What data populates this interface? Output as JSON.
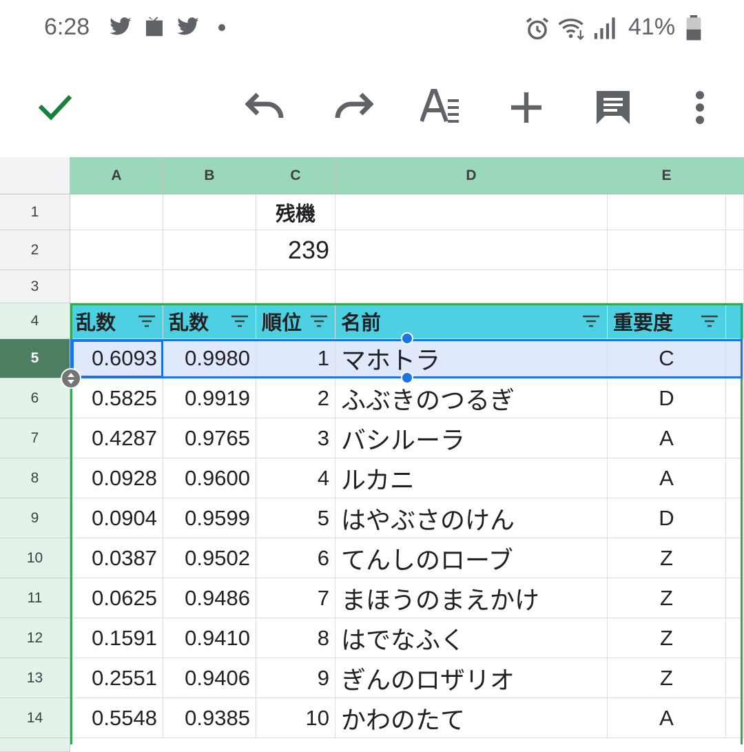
{
  "status_bar": {
    "time": "6:28",
    "battery": "41%",
    "icons": [
      "twitter-icon",
      "tv-icon",
      "twitter-icon",
      "dot-icon",
      "alarm-icon",
      "wifi-icon",
      "signal-icon",
      "battery-icon"
    ]
  },
  "toolbar": {
    "icons": [
      "check-icon",
      "undo-icon",
      "redo-icon",
      "text-format-icon",
      "add-icon",
      "comment-icon",
      "more-vert-icon"
    ],
    "accent": "#188038"
  },
  "sheet": {
    "columns": [
      "A",
      "B",
      "C",
      "D",
      "E"
    ],
    "rows": [
      "1",
      "2",
      "3",
      "4",
      "5",
      "6",
      "7",
      "8",
      "9",
      "10",
      "11",
      "12",
      "13",
      "14"
    ],
    "c1": "残機",
    "c2": "239",
    "headers": [
      "乱数",
      "乱数",
      "順位",
      "名前",
      "重要度"
    ],
    "data": [
      [
        "0.6093",
        "0.9980",
        "1",
        "マホトラ",
        "C"
      ],
      [
        "0.5825",
        "0.9919",
        "2",
        "ふぶきのつるぎ",
        "D"
      ],
      [
        "0.4287",
        "0.9765",
        "3",
        "バシルーラ",
        "A"
      ],
      [
        "0.0928",
        "0.9600",
        "4",
        "ルカニ",
        "A"
      ],
      [
        "0.0904",
        "0.9599",
        "5",
        "はやぶさのけん",
        "D"
      ],
      [
        "0.0387",
        "0.9502",
        "6",
        "てんしのローブ",
        "Z"
      ],
      [
        "0.0625",
        "0.9486",
        "7",
        "まほうのまえかけ",
        "Z"
      ],
      [
        "0.1591",
        "0.9410",
        "8",
        "はでなふく",
        "Z"
      ],
      [
        "0.2551",
        "0.9406",
        "9",
        "ぎんのロザリオ",
        "Z"
      ],
      [
        "0.5548",
        "0.9385",
        "10",
        "かわのたて",
        "A"
      ]
    ],
    "colors": {
      "column_header": "#9bd8b9",
      "table_header": "#4dd0e1",
      "selection": "#1a73e8",
      "table_border": "#34a853"
    }
  }
}
